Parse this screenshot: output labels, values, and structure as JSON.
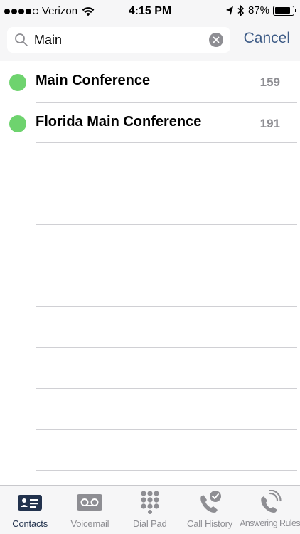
{
  "status_bar": {
    "carrier": "Verizon",
    "time": "4:15 PM",
    "battery": "87%",
    "battery_level": 0.87
  },
  "search": {
    "value": "Main",
    "cancel_label": "Cancel"
  },
  "results": [
    {
      "name": "Main Conference",
      "extension": "159",
      "presence": "available"
    },
    {
      "name": "Florida Main Conference",
      "extension": "191",
      "presence": "available"
    }
  ],
  "tabs": [
    {
      "label": "Contacts",
      "icon": "contacts-icon",
      "active": true
    },
    {
      "label": "Voicemail",
      "icon": "voicemail-icon",
      "active": false
    },
    {
      "label": "Dial Pad",
      "icon": "dialpad-icon",
      "active": false
    },
    {
      "label": "Call History",
      "icon": "call-history-icon",
      "active": false
    },
    {
      "label": "Answering Rules",
      "icon": "answering-rules-icon",
      "active": false
    }
  ],
  "colors": {
    "accent": "#3d5b86",
    "active_tab": "#22324d",
    "presence_available": "#6ed36e",
    "muted": "#8e8e93"
  }
}
